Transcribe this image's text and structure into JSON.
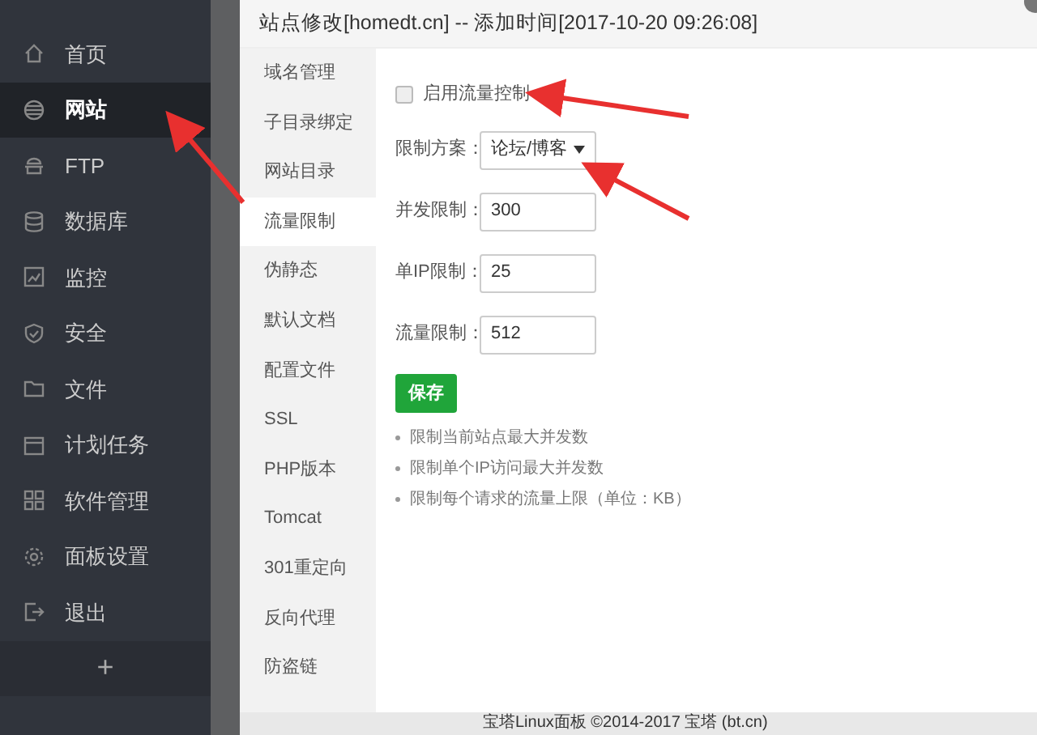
{
  "sidebar": {
    "items": [
      {
        "label": "首页",
        "selected": false
      },
      {
        "label": "网站",
        "selected": true
      },
      {
        "label": "FTP",
        "selected": false
      },
      {
        "label": "数据库",
        "selected": false
      },
      {
        "label": "监控",
        "selected": false
      },
      {
        "label": "安全",
        "selected": false
      },
      {
        "label": "文件",
        "selected": false
      },
      {
        "label": "计划任务",
        "selected": false
      },
      {
        "label": "软件管理",
        "selected": false
      },
      {
        "label": "面板设置",
        "selected": false
      },
      {
        "label": "退出",
        "selected": false
      }
    ],
    "add_button": "+"
  },
  "dialog": {
    "title": "站点修改[homedt.cn] -- 添加时间[2017-10-20 09:26:08]",
    "tabs": [
      {
        "label": "域名管理",
        "selected": false
      },
      {
        "label": "子目录绑定",
        "selected": false
      },
      {
        "label": "网站目录",
        "selected": false
      },
      {
        "label": "流量限制",
        "selected": true
      },
      {
        "label": "伪静态",
        "selected": false
      },
      {
        "label": "默认文档",
        "selected": false
      },
      {
        "label": "配置文件",
        "selected": false
      },
      {
        "label": "SSL",
        "selected": false
      },
      {
        "label": "PHP版本",
        "selected": false
      },
      {
        "label": "Tomcat",
        "selected": false
      },
      {
        "label": "301重定向",
        "selected": false
      },
      {
        "label": "反向代理",
        "selected": false
      },
      {
        "label": "防盗链",
        "selected": false
      }
    ],
    "enable": {
      "label": "启用流量控制",
      "checked": false
    },
    "fields": [
      {
        "kind": "select",
        "label": "限制方案：",
        "value": "论坛/博客"
      },
      {
        "kind": "input",
        "label": "并发限制：",
        "value": "300"
      },
      {
        "kind": "input",
        "label": "单IP限制：",
        "value": "25"
      },
      {
        "kind": "input",
        "label": "流量限制：",
        "value": "512"
      }
    ],
    "save_button": "保存",
    "notes": [
      "限制当前站点最大并发数",
      "限制单个IP访问最大并发数",
      "限制每个请求的流量上限（单位：KB）"
    ]
  },
  "footer": "宝塔Linux面板 ©2014-2017 宝塔 (bt.cn)"
}
